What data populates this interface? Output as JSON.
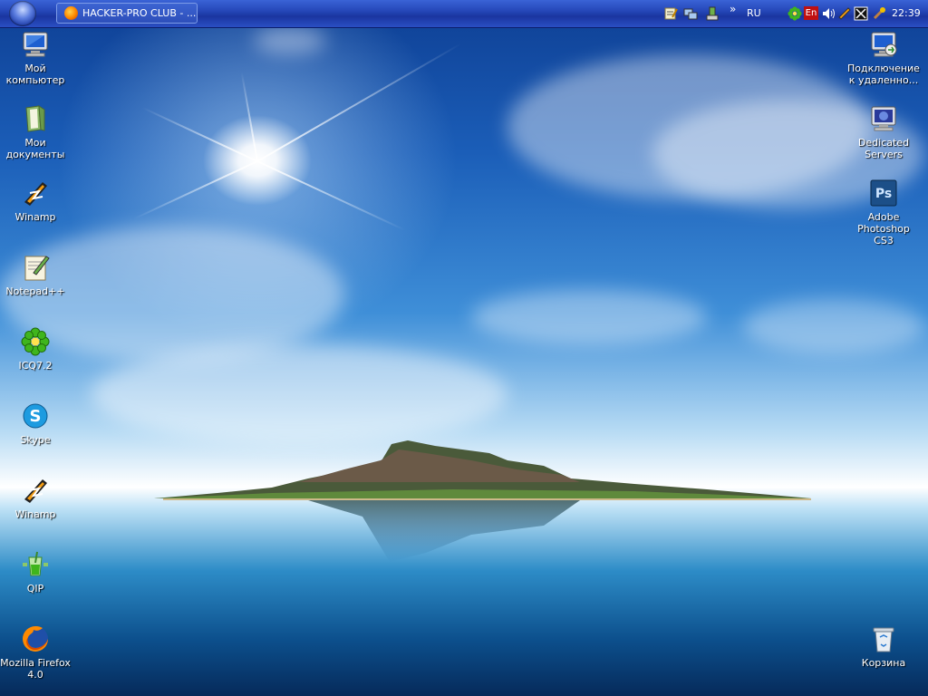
{
  "taskbar": {
    "task_button_label": "HACKER-PRO CLUB - ...",
    "tray": {
      "overflow_chevron": "»",
      "language_ru": "RU",
      "language_en": "En",
      "clock": "22:39"
    }
  },
  "desktop": {
    "left_icons": [
      {
        "label": "Мой\nкомпьютер",
        "icon": "my-computer-icon"
      },
      {
        "label": "Мои\nдокументы",
        "icon": "my-documents-icon"
      },
      {
        "label": "Winamp",
        "icon": "winamp-icon"
      },
      {
        "label": "Notepad++",
        "icon": "notepad-plus-plus-icon"
      },
      {
        "label": "ICQ7.2",
        "icon": "icq-icon"
      },
      {
        "label": "Skype",
        "icon": "skype-icon"
      },
      {
        "label": "Winamp",
        "icon": "winamp-icon"
      },
      {
        "label": "QIP",
        "icon": "qip-icon"
      },
      {
        "label": "Mozilla Firefox\n4.0",
        "icon": "firefox-icon"
      }
    ],
    "right_icons": [
      {
        "label": "Подключение\nк удаленно...",
        "icon": "remote-desktop-icon"
      },
      {
        "label": "Dedicated\nServers",
        "icon": "dedicated-servers-icon"
      },
      {
        "label": "Adobe\nPhotoshop CS3",
        "icon": "photoshop-icon",
        "glyph": "Ps"
      },
      {
        "label": "Корзина",
        "icon": "recycle-bin-icon"
      }
    ]
  },
  "colors": {
    "taskbar": "#2547b8",
    "sky_top": "#0e3f94",
    "sea": "#0c4f8c",
    "icq_green": "#3fb51d",
    "skype_blue": "#1d9be0"
  }
}
